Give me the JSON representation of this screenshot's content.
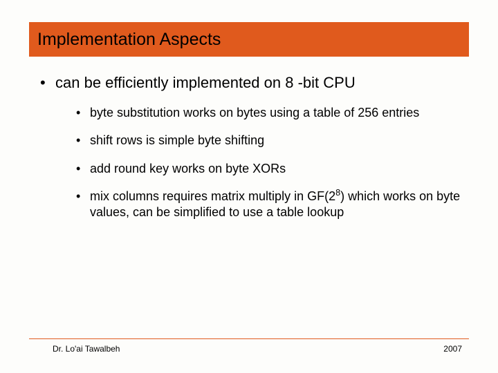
{
  "slide": {
    "title": "Implementation Aspects",
    "bullet_lvl1": "can be efficiently implemented on 8 -bit CPU",
    "bullets_lvl2": {
      "b0": "byte substitution works on bytes using a table of 256 entries",
      "b1": "shift rows is simple byte shifting",
      "b2": "add round key works on byte XORs",
      "b3_pre": "mix columns requires matrix multiply in GF(2",
      "b3_sup": "8",
      "b3_post": ") which works on byte values, can be simplified to use a table lookup"
    },
    "footer": {
      "author": "Dr. Lo'ai Tawalbeh",
      "year": "2007"
    }
  }
}
